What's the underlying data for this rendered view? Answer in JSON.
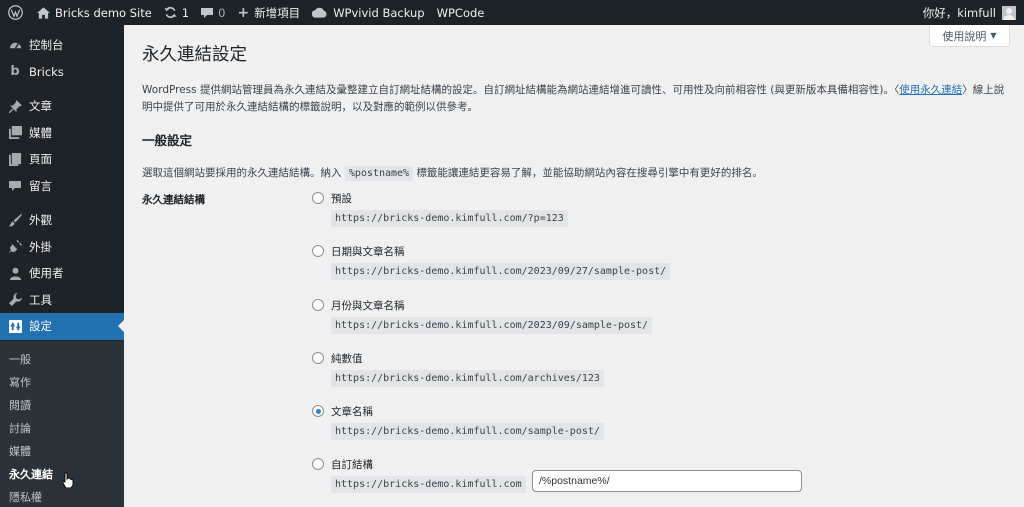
{
  "adminbar": {
    "site_name": "Bricks demo Site",
    "updates_count": "1",
    "comments_count": "0",
    "new_label": "新增項目",
    "wpvivid_label": "WPvivid Backup",
    "wpcode_label": "WPCode",
    "greeting": "你好，kimfull"
  },
  "help_tab": {
    "label": "使用說明"
  },
  "sidebar": {
    "items": [
      {
        "label": "控制台",
        "icon": "dashboard-icon"
      },
      {
        "label": "Bricks",
        "icon": "bricks-icon"
      },
      {
        "label": "文章",
        "icon": "pin-icon"
      },
      {
        "label": "媒體",
        "icon": "media-icon"
      },
      {
        "label": "頁面",
        "icon": "page-icon"
      },
      {
        "label": "留言",
        "icon": "comment-icon"
      },
      {
        "label": "外觀",
        "icon": "brush-icon"
      },
      {
        "label": "外掛",
        "icon": "plugin-icon"
      },
      {
        "label": "使用者",
        "icon": "user-icon"
      },
      {
        "label": "工具",
        "icon": "wrench-icon"
      },
      {
        "label": "設定",
        "icon": "settings-icon"
      }
    ],
    "submenu": [
      "一般",
      "寫作",
      "閱讀",
      "討論",
      "媒體",
      "永久連結",
      "隱私權"
    ]
  },
  "page": {
    "title": "永久連結設定",
    "intro_text": "WordPress 提供網站管理員為永久連結及彙整建立自訂網址結構的設定。自訂網址結構能為網站連結增進可讀性、可用性及向前相容性 (與更新版本具備相容性)。〈",
    "intro_link": "使用永久連結",
    "intro_after": "〉線上說明中提供了可用於永久連結結構的標籤說明，以及對應的範例以供參考。",
    "section_title": "一般設定",
    "desc_before": "選取這個網站要採用的永久連結結構。納入 ",
    "desc_code": "%postname%",
    "desc_after": " 標籤能讓連結更容易了解，並能協助網站內容在搜尋引擎中有更好的排名。",
    "field_label": "永久連結結構",
    "options": [
      {
        "label": "預設",
        "example": "https://bricks-demo.kimfull.com/?p=123",
        "checked": false
      },
      {
        "label": "日期與文章名稱",
        "example": "https://bricks-demo.kimfull.com/2023/09/27/sample-post/",
        "checked": false
      },
      {
        "label": "月份與文章名稱",
        "example": "https://bricks-demo.kimfull.com/2023/09/sample-post/",
        "checked": false
      },
      {
        "label": "純數值",
        "example": "https://bricks-demo.kimfull.com/archives/123",
        "checked": false
      },
      {
        "label": "文章名稱",
        "example": "https://bricks-demo.kimfull.com/sample-post/",
        "checked": true
      },
      {
        "label": "自訂結構",
        "example": "https://bricks-demo.kimfull.com",
        "checked": false
      }
    ],
    "custom_value": "/%postname%/"
  },
  "colors": {
    "accent": "#2271b1",
    "adminbar": "#1d2327",
    "background": "#f0f0f1"
  }
}
